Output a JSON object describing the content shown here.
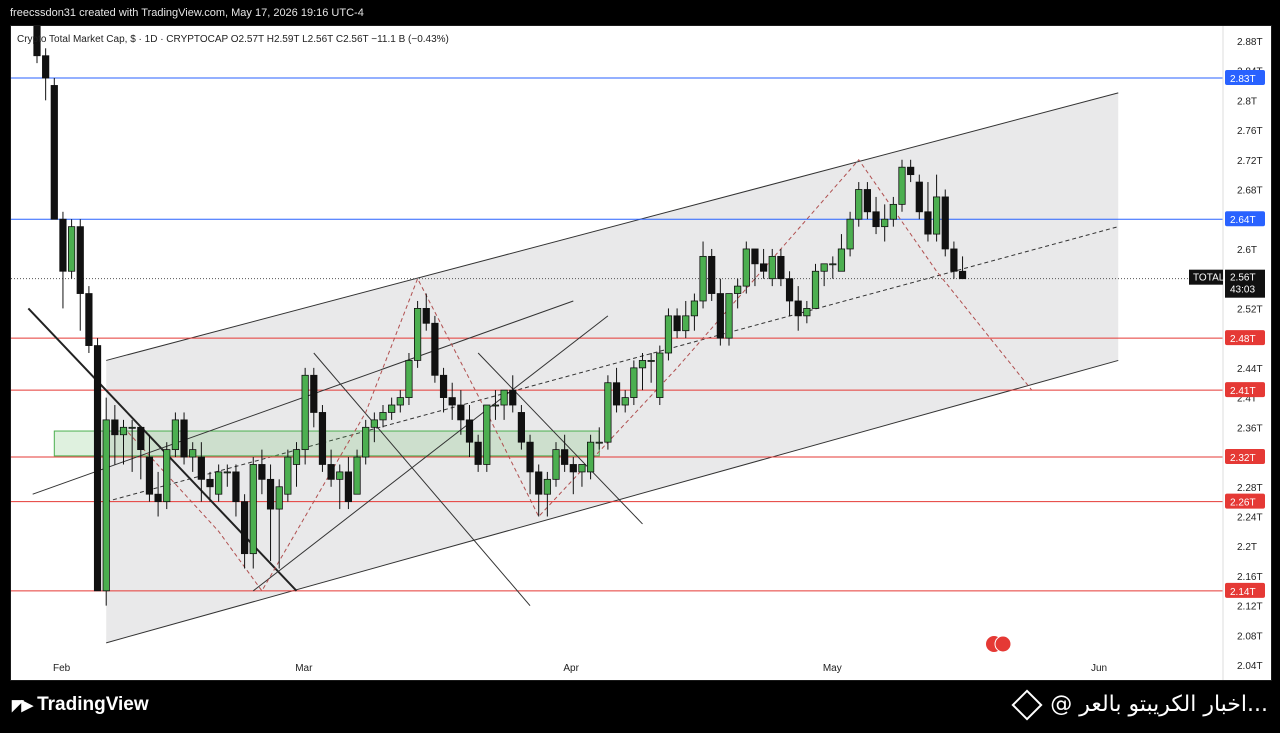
{
  "header": {
    "credit": "freecssdon31 created with TradingView.com, May 17, 2026 19:16 UTC-4",
    "symbol_line": "Crypto Total Market Cap, $ · 1D · CRYPTOCAP  O2.57T  H2.59T  L2.56T  C2.56T  −11.1 B (−0.43%)"
  },
  "footer": {
    "brand": "TradingView",
    "watermark": "@ اخبار الكريبتو بالعر..."
  },
  "colors": {
    "up": "#4caf50",
    "down": "#111111",
    "channel_fill": "#e9e9ea",
    "red_level": "#e53935",
    "blue_level": "#2962ff",
    "green_zone": "#4caf50"
  },
  "chart_data": {
    "type": "candlestick",
    "symbol": "TOTAL",
    "interval": "1D",
    "ylim": [
      2.02,
      2.9
    ],
    "y_ticks": [
      "2.88T",
      "2.84T",
      "2.8T",
      "2.76T",
      "2.72T",
      "2.68T",
      "2.64T",
      "2.6T",
      "2.56T",
      "2.52T",
      "2.48T",
      "2.44T",
      "2.4T",
      "2.36T",
      "2.32T",
      "2.28T",
      "2.24T",
      "2.2T",
      "2.16T",
      "2.12T",
      "2.08T",
      "2.04T"
    ],
    "y_tick_values": [
      2.88,
      2.84,
      2.8,
      2.76,
      2.72,
      2.68,
      2.64,
      2.6,
      2.56,
      2.52,
      2.48,
      2.44,
      2.4,
      2.36,
      2.32,
      2.28,
      2.24,
      2.2,
      2.16,
      2.12,
      2.08,
      2.04
    ],
    "x_labels": [
      {
        "label": "Feb",
        "index": 0
      },
      {
        "label": "Mar",
        "index": 28
      },
      {
        "label": "Apr",
        "index": 59
      },
      {
        "label": "May",
        "index": 89
      },
      {
        "label": "Jun",
        "index": 120
      }
    ],
    "candles": [
      {
        "o": 2.92,
        "h": 2.95,
        "l": 2.85,
        "c": 2.86
      },
      {
        "o": 2.86,
        "h": 2.87,
        "l": 2.8,
        "c": 2.83
      },
      {
        "o": 2.82,
        "h": 2.83,
        "l": 2.64,
        "c": 2.64
      },
      {
        "o": 2.64,
        "h": 2.65,
        "l": 2.52,
        "c": 2.57
      },
      {
        "o": 2.57,
        "h": 2.64,
        "l": 2.56,
        "c": 2.63
      },
      {
        "o": 2.63,
        "h": 2.64,
        "l": 2.49,
        "c": 2.54
      },
      {
        "o": 2.54,
        "h": 2.55,
        "l": 2.46,
        "c": 2.47
      },
      {
        "o": 2.47,
        "h": 2.48,
        "l": 2.14,
        "c": 2.14
      },
      {
        "o": 2.14,
        "h": 2.4,
        "l": 2.12,
        "c": 2.37
      },
      {
        "o": 2.37,
        "h": 2.39,
        "l": 2.31,
        "c": 2.35
      },
      {
        "o": 2.35,
        "h": 2.37,
        "l": 2.31,
        "c": 2.36
      },
      {
        "o": 2.36,
        "h": 2.37,
        "l": 2.3,
        "c": 2.36
      },
      {
        "o": 2.36,
        "h": 2.36,
        "l": 2.29,
        "c": 2.33
      },
      {
        "o": 2.32,
        "h": 2.35,
        "l": 2.26,
        "c": 2.27
      },
      {
        "o": 2.27,
        "h": 2.3,
        "l": 2.24,
        "c": 2.26
      },
      {
        "o": 2.26,
        "h": 2.34,
        "l": 2.25,
        "c": 2.33
      },
      {
        "o": 2.33,
        "h": 2.38,
        "l": 2.32,
        "c": 2.37
      },
      {
        "o": 2.37,
        "h": 2.38,
        "l": 2.31,
        "c": 2.32
      },
      {
        "o": 2.32,
        "h": 2.34,
        "l": 2.3,
        "c": 2.33
      },
      {
        "o": 2.32,
        "h": 2.34,
        "l": 2.26,
        "c": 2.29
      },
      {
        "o": 2.29,
        "h": 2.3,
        "l": 2.26,
        "c": 2.28
      },
      {
        "o": 2.27,
        "h": 2.31,
        "l": 2.26,
        "c": 2.3
      },
      {
        "o": 2.3,
        "h": 2.31,
        "l": 2.28,
        "c": 2.3
      },
      {
        "o": 2.3,
        "h": 2.31,
        "l": 2.24,
        "c": 2.26
      },
      {
        "o": 2.26,
        "h": 2.27,
        "l": 2.17,
        "c": 2.19
      },
      {
        "o": 2.19,
        "h": 2.32,
        "l": 2.17,
        "c": 2.31
      },
      {
        "o": 2.31,
        "h": 2.33,
        "l": 2.27,
        "c": 2.29
      },
      {
        "o": 2.29,
        "h": 2.31,
        "l": 2.18,
        "c": 2.25
      },
      {
        "o": 2.25,
        "h": 2.29,
        "l": 2.17,
        "c": 2.28
      },
      {
        "o": 2.27,
        "h": 2.33,
        "l": 2.26,
        "c": 2.32
      },
      {
        "o": 2.31,
        "h": 2.34,
        "l": 2.28,
        "c": 2.33
      },
      {
        "o": 2.33,
        "h": 2.44,
        "l": 2.31,
        "c": 2.43
      },
      {
        "o": 2.43,
        "h": 2.44,
        "l": 2.36,
        "c": 2.38
      },
      {
        "o": 2.38,
        "h": 2.39,
        "l": 2.3,
        "c": 2.31
      },
      {
        "o": 2.31,
        "h": 2.33,
        "l": 2.28,
        "c": 2.29
      },
      {
        "o": 2.29,
        "h": 2.31,
        "l": 2.25,
        "c": 2.3
      },
      {
        "o": 2.3,
        "h": 2.32,
        "l": 2.25,
        "c": 2.26
      },
      {
        "o": 2.27,
        "h": 2.33,
        "l": 2.27,
        "c": 2.32
      },
      {
        "o": 2.32,
        "h": 2.37,
        "l": 2.31,
        "c": 2.36
      },
      {
        "o": 2.36,
        "h": 2.38,
        "l": 2.34,
        "c": 2.37
      },
      {
        "o": 2.37,
        "h": 2.39,
        "l": 2.36,
        "c": 2.38
      },
      {
        "o": 2.38,
        "h": 2.4,
        "l": 2.37,
        "c": 2.39
      },
      {
        "o": 2.39,
        "h": 2.41,
        "l": 2.38,
        "c": 2.4
      },
      {
        "o": 2.4,
        "h": 2.46,
        "l": 2.39,
        "c": 2.45
      },
      {
        "o": 2.45,
        "h": 2.53,
        "l": 2.44,
        "c": 2.52
      },
      {
        "o": 2.52,
        "h": 2.54,
        "l": 2.49,
        "c": 2.5
      },
      {
        "o": 2.5,
        "h": 2.51,
        "l": 2.42,
        "c": 2.43
      },
      {
        "o": 2.43,
        "h": 2.44,
        "l": 2.38,
        "c": 2.4
      },
      {
        "o": 2.4,
        "h": 2.42,
        "l": 2.37,
        "c": 2.39
      },
      {
        "o": 2.39,
        "h": 2.41,
        "l": 2.35,
        "c": 2.37
      },
      {
        "o": 2.37,
        "h": 2.39,
        "l": 2.32,
        "c": 2.34
      },
      {
        "o": 2.34,
        "h": 2.35,
        "l": 2.3,
        "c": 2.31
      },
      {
        "o": 2.31,
        "h": 2.39,
        "l": 2.3,
        "c": 2.39
      },
      {
        "o": 2.39,
        "h": 2.41,
        "l": 2.37,
        "c": 2.39
      },
      {
        "o": 2.39,
        "h": 2.41,
        "l": 2.37,
        "c": 2.41
      },
      {
        "o": 2.41,
        "h": 2.43,
        "l": 2.38,
        "c": 2.39
      },
      {
        "o": 2.38,
        "h": 2.39,
        "l": 2.33,
        "c": 2.34
      },
      {
        "o": 2.34,
        "h": 2.35,
        "l": 2.27,
        "c": 2.3
      },
      {
        "o": 2.3,
        "h": 2.31,
        "l": 2.24,
        "c": 2.27
      },
      {
        "o": 2.27,
        "h": 2.3,
        "l": 2.24,
        "c": 2.29
      },
      {
        "o": 2.29,
        "h": 2.34,
        "l": 2.28,
        "c": 2.33
      },
      {
        "o": 2.33,
        "h": 2.35,
        "l": 2.3,
        "c": 2.31
      },
      {
        "o": 2.31,
        "h": 2.32,
        "l": 2.27,
        "c": 2.3
      },
      {
        "o": 2.3,
        "h": 2.31,
        "l": 2.28,
        "c": 2.31
      },
      {
        "o": 2.3,
        "h": 2.35,
        "l": 2.29,
        "c": 2.34
      },
      {
        "o": 2.34,
        "h": 2.36,
        "l": 2.33,
        "c": 2.34
      },
      {
        "o": 2.34,
        "h": 2.43,
        "l": 2.33,
        "c": 2.42
      },
      {
        "o": 2.42,
        "h": 2.44,
        "l": 2.38,
        "c": 2.39
      },
      {
        "o": 2.39,
        "h": 2.41,
        "l": 2.38,
        "c": 2.4
      },
      {
        "o": 2.4,
        "h": 2.45,
        "l": 2.39,
        "c": 2.44
      },
      {
        "o": 2.44,
        "h": 2.46,
        "l": 2.41,
        "c": 2.45
      },
      {
        "o": 2.45,
        "h": 2.46,
        "l": 2.42,
        "c": 2.45
      },
      {
        "o": 2.4,
        "h": 2.47,
        "l": 2.39,
        "c": 2.46
      },
      {
        "o": 2.46,
        "h": 2.52,
        "l": 2.45,
        "c": 2.51
      },
      {
        "o": 2.51,
        "h": 2.52,
        "l": 2.48,
        "c": 2.49
      },
      {
        "o": 2.49,
        "h": 2.53,
        "l": 2.48,
        "c": 2.51
      },
      {
        "o": 2.51,
        "h": 2.54,
        "l": 2.49,
        "c": 2.53
      },
      {
        "o": 2.53,
        "h": 2.61,
        "l": 2.52,
        "c": 2.59
      },
      {
        "o": 2.59,
        "h": 2.6,
        "l": 2.53,
        "c": 2.54
      },
      {
        "o": 2.54,
        "h": 2.56,
        "l": 2.47,
        "c": 2.48
      },
      {
        "o": 2.48,
        "h": 2.54,
        "l": 2.47,
        "c": 2.54
      },
      {
        "o": 2.54,
        "h": 2.56,
        "l": 2.52,
        "c": 2.55
      },
      {
        "o": 2.55,
        "h": 2.61,
        "l": 2.54,
        "c": 2.6
      },
      {
        "o": 2.6,
        "h": 2.6,
        "l": 2.55,
        "c": 2.58
      },
      {
        "o": 2.58,
        "h": 2.6,
        "l": 2.56,
        "c": 2.57
      },
      {
        "o": 2.56,
        "h": 2.6,
        "l": 2.55,
        "c": 2.59
      },
      {
        "o": 2.59,
        "h": 2.6,
        "l": 2.55,
        "c": 2.56
      },
      {
        "o": 2.56,
        "h": 2.57,
        "l": 2.51,
        "c": 2.53
      },
      {
        "o": 2.53,
        "h": 2.55,
        "l": 2.49,
        "c": 2.51
      },
      {
        "o": 2.51,
        "h": 2.53,
        "l": 2.5,
        "c": 2.52
      },
      {
        "o": 2.52,
        "h": 2.58,
        "l": 2.52,
        "c": 2.57
      },
      {
        "o": 2.57,
        "h": 2.58,
        "l": 2.55,
        "c": 2.58
      },
      {
        "o": 2.58,
        "h": 2.59,
        "l": 2.56,
        "c": 2.58
      },
      {
        "o": 2.57,
        "h": 2.62,
        "l": 2.57,
        "c": 2.6
      },
      {
        "o": 2.6,
        "h": 2.65,
        "l": 2.59,
        "c": 2.64
      },
      {
        "o": 2.64,
        "h": 2.69,
        "l": 2.63,
        "c": 2.68
      },
      {
        "o": 2.68,
        "h": 2.69,
        "l": 2.64,
        "c": 2.65
      },
      {
        "o": 2.65,
        "h": 2.67,
        "l": 2.62,
        "c": 2.63
      },
      {
        "o": 2.63,
        "h": 2.66,
        "l": 2.61,
        "c": 2.64
      },
      {
        "o": 2.64,
        "h": 2.67,
        "l": 2.63,
        "c": 2.66
      },
      {
        "o": 2.66,
        "h": 2.72,
        "l": 2.65,
        "c": 2.71
      },
      {
        "o": 2.71,
        "h": 2.72,
        "l": 2.69,
        "c": 2.7
      },
      {
        "o": 2.69,
        "h": 2.7,
        "l": 2.64,
        "c": 2.65
      },
      {
        "o": 2.65,
        "h": 2.69,
        "l": 2.61,
        "c": 2.62
      },
      {
        "o": 2.62,
        "h": 2.7,
        "l": 2.61,
        "c": 2.67
      },
      {
        "o": 2.67,
        "h": 2.68,
        "l": 2.59,
        "c": 2.6
      },
      {
        "o": 2.6,
        "h": 2.61,
        "l": 2.56,
        "c": 2.57
      },
      {
        "o": 2.57,
        "h": 2.59,
        "l": 2.56,
        "c": 2.56
      }
    ],
    "horizontal_levels": [
      {
        "value": 2.83,
        "label": "2.83T",
        "color": "#2962ff"
      },
      {
        "value": 2.64,
        "label": "2.64T",
        "color": "#2962ff"
      },
      {
        "value": 2.48,
        "label": "2.48T",
        "color": "#e53935"
      },
      {
        "value": 2.41,
        "label": "2.41T",
        "color": "#e53935"
      },
      {
        "value": 2.32,
        "label": "2.32T",
        "color": "#e53935"
      },
      {
        "value": 2.26,
        "label": "2.26T",
        "color": "#e53935"
      },
      {
        "value": 2.14,
        "label": "2.14T",
        "color": "#e53935"
      }
    ],
    "last_price": {
      "symbol": "TOTAL",
      "value": 2.56,
      "label": "2.56T",
      "countdown": "43:03"
    },
    "channel": {
      "upper": [
        {
          "i": 8,
          "v": 2.45
        },
        {
          "i": 125,
          "v": 2.81
        }
      ],
      "lower": [
        {
          "i": 8,
          "v": 2.07
        },
        {
          "i": 125,
          "v": 2.45
        }
      ]
    },
    "green_zone": {
      "i0": 2,
      "i1": 65,
      "v0": 2.335,
      "v1": 2.355
    },
    "grid": false,
    "legend": "none"
  }
}
